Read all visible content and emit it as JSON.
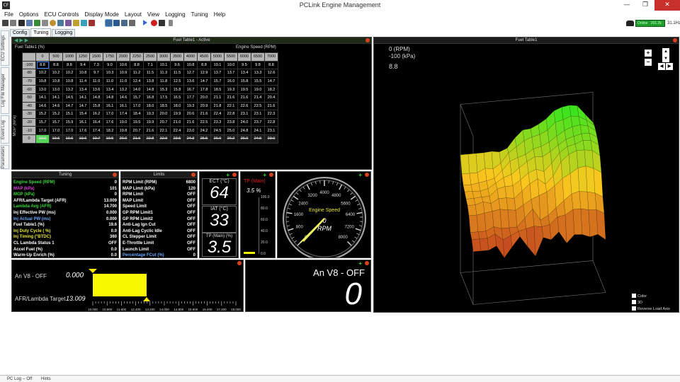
{
  "window": {
    "title": "PCLink Engine Management",
    "minimize": "—",
    "restore": "❐",
    "close": "✕",
    "app_icon": "CF"
  },
  "menu": [
    "File",
    "Options",
    "ECU Controls",
    "Display Mode",
    "Layout",
    "View",
    "Logging",
    "Tuning",
    "Help"
  ],
  "status_online": "Online",
  "status_online_value": "201.2k",
  "status_fps": "31.1Hz",
  "side_tabs": [
    "ECU Settings",
    "Log File Manager",
    "Event Log",
    "Parameters"
  ],
  "page_tabs": [
    "Config",
    "Tuning",
    "Logging"
  ],
  "fuel_table": {
    "title": "Fuel Table1 - Active",
    "table_label": "Fuel Table1 (%)",
    "rpm_label": "Engine Speed (RPM)",
    "map_label": "MGP (kPa)",
    "rpm": [
      "0",
      "500",
      "1000",
      "1250",
      "1500",
      "1750",
      "2000",
      "2250",
      "2500",
      "3000",
      "3500",
      "4000",
      "4500",
      "5000",
      "5500",
      "6000",
      "6500",
      "7000"
    ],
    "rows": [
      {
        "map": "-100",
        "cells": [
          "8.8",
          "8.8",
          "8.8",
          "9.4",
          "7.3",
          "9.0",
          "10.6",
          "8.8",
          "7.1",
          "10.1",
          "9.6",
          "10.8",
          "8.8",
          "10.1",
          "10.0",
          "9.5",
          "9.8",
          "8.8"
        ]
      },
      {
        "map": "-80",
        "cells": [
          "10.2",
          "10.2",
          "10.2",
          "10.8",
          "9.7",
          "10.3",
          "10.9",
          "11.2",
          "11.5",
          "11.3",
          "11.5",
          "12.7",
          "12.9",
          "13.7",
          "13.7",
          "13.4",
          "13.3",
          "12.6"
        ]
      },
      {
        "map": "-70",
        "cells": [
          "10.8",
          "10.8",
          "10.8",
          "11.4",
          "11.0",
          "11.0",
          "11.0",
          "12.4",
          "13.8",
          "11.8",
          "12.5",
          "13.6",
          "14.7",
          "15.7",
          "16.0",
          "15.8",
          "15.5",
          "14.7"
        ]
      },
      {
        "map": "-60",
        "cells": [
          "13.0",
          "13.0",
          "13.2",
          "13.4",
          "13.6",
          "13.4",
          "13.2",
          "14.0",
          "14.8",
          "15.3",
          "15.8",
          "16.7",
          "17.8",
          "18.5",
          "19.3",
          "19.5",
          "19.0",
          "18.2"
        ]
      },
      {
        "map": "-50",
        "cells": [
          "14.1",
          "14.1",
          "14.5",
          "14.1",
          "14.8",
          "14.8",
          "14.6",
          "15.7",
          "16.8",
          "17.5",
          "16.5",
          "17.7",
          "20.0",
          "21.1",
          "21.6",
          "21.6",
          "21.4",
          "20.4"
        ]
      },
      {
        "map": "-40",
        "cells": [
          "14.6",
          "14.6",
          "14.7",
          "14.7",
          "15.8",
          "16.1",
          "16.1",
          "17.0",
          "18.0",
          "18.5",
          "18.0",
          "19.3",
          "20.9",
          "21.8",
          "22.1",
          "22.6",
          "22.5",
          "21.6"
        ]
      },
      {
        "map": "-30",
        "cells": [
          "15.2",
          "15.2",
          "15.1",
          "15.4",
          "16.2",
          "17.0",
          "17.4",
          "18.4",
          "19.3",
          "20.0",
          "19.9",
          "20.6",
          "21.6",
          "22.4",
          "22.8",
          "23.1",
          "23.1",
          "22.3"
        ]
      },
      {
        "map": "-20",
        "cells": [
          "15.7",
          "15.7",
          "15.9",
          "16.1",
          "16.4",
          "17.6",
          "19.0",
          "19.5",
          "19.9",
          "20.7",
          "21.0",
          "21.6",
          "22.5",
          "23.3",
          "23.8",
          "24.0",
          "23.7",
          "22.8"
        ]
      },
      {
        "map": "-10",
        "cells": [
          "17.0",
          "17.0",
          "17.0",
          "17.6",
          "17.4",
          "18.2",
          "19.8",
          "20.7",
          "21.6",
          "22.1",
          "22.4",
          "23.0",
          "24.2",
          "24.5",
          "25.0",
          "24.8",
          "24.1",
          "23.1"
        ]
      },
      {
        "map": "0",
        "cells": [
          "19.6",
          "19.6",
          "19.6",
          "19.6",
          "19.7",
          "19.5",
          "20.0",
          "21.6",
          "22.8",
          "22.9",
          "23.5",
          "24.3",
          "25.5",
          "26.0",
          "26.2",
          "26.0",
          "24.5",
          "23.0"
        ]
      }
    ]
  },
  "graph3d": {
    "title": "Fuel Table1",
    "line1": "0 (RPM)",
    "line2": "-100 (kPa)",
    "value": "8.8",
    "checks": [
      "Color",
      "3D",
      "Reverse Load Axis"
    ]
  },
  "tuning": {
    "title": "Tuning",
    "items": [
      {
        "label": "Engine Speed (RPM)",
        "value": "0",
        "color": "#38d838"
      },
      {
        "label": "MAP (kPa)",
        "value": "101",
        "color": "#e040e0"
      },
      {
        "label": "MGP (kPa)",
        "value": "0",
        "color": "#38d838"
      },
      {
        "label": "AFR/Lambda Target (AFR)",
        "value": "13.009",
        "color": "#ffffff"
      },
      {
        "label": "Lambda Avg (AFR)",
        "value": "14.700",
        "color": "#38d838"
      },
      {
        "label": "Inj Effective PW (ms)",
        "value": "0.000",
        "color": "#ffffff"
      },
      {
        "label": "Inj Actual PW (ms)",
        "value": "0.000",
        "color": "#6aa8ff"
      },
      {
        "label": "Fuel Table1 (%)",
        "value": "19.6",
        "color": "#ffffff"
      },
      {
        "label": "Inj Duty Cycle ( %)",
        "value": "0.0",
        "color": "#e8e830"
      },
      {
        "label": "Inj Timing (°BTDC)",
        "value": "360",
        "color": "#e8e830"
      },
      {
        "label": "CL Lambda Status 1",
        "value": "OFF",
        "color": "#ffffff"
      },
      {
        "label": "Accel Fuel (%)",
        "value": "0.0",
        "color": "#ffffff"
      },
      {
        "label": "Warm-Up Enrich (%)",
        "value": "0.0",
        "color": "#ffffff"
      }
    ]
  },
  "limits": {
    "title": "Limits",
    "items": [
      {
        "label": "RPM Limit (RPM)",
        "value": "6800",
        "color": "#ffffff"
      },
      {
        "label": "MAP Limit (kPa)",
        "value": "120",
        "color": "#ffffff"
      },
      {
        "label": "RPM Limit",
        "value": "OFF",
        "color": "#ffffff"
      },
      {
        "label": "MAP Limit",
        "value": "OFF",
        "color": "#ffffff"
      },
      {
        "label": "Speed Limit",
        "value": "OFF",
        "color": "#ffffff"
      },
      {
        "label": "GP RPM Limit1",
        "value": "OFF",
        "color": "#ffffff"
      },
      {
        "label": "GP RPM Limit2",
        "value": "OFF",
        "color": "#ffffff"
      },
      {
        "label": "Anti-Lag Ign Cut",
        "value": "OFF",
        "color": "#ffffff"
      },
      {
        "label": "Anti-Lag Cyclic Idle",
        "value": "OFF",
        "color": "#ffffff"
      },
      {
        "label": "CL Stepper Limit",
        "value": "OFF",
        "color": "#ffffff"
      },
      {
        "label": "E-Throttle Limit",
        "value": "OFF",
        "color": "#ffffff"
      },
      {
        "label": "Launch Limit",
        "value": "OFF",
        "color": "#ffffff"
      },
      {
        "label": "Percentage FCut (%)",
        "value": "0",
        "color": "#6aa8ff"
      }
    ]
  },
  "gauges": {
    "ect_label": "ECT (°C)",
    "ect": "64",
    "iat_label": "IAT (°C)",
    "iat": "33",
    "tp_label": "TP (Main) (%)",
    "tp": "3.5",
    "tp_bar_label": "TP (Main)",
    "tp_bar_value": "3.5 %",
    "tp_bar_fraction": 0.035,
    "tp_scale": [
      "100.0",
      "80.0",
      "60.0",
      "40.0",
      "20.0",
      "0.0"
    ],
    "rpm_title": "Engine Speed",
    "rpm_value": "0",
    "rpm_unit": "RPM",
    "rpm_ticks": [
      "0",
      "800",
      "1600",
      "2400",
      "3200",
      "4000",
      "4800",
      "5600",
      "6400",
      "7200",
      "8000"
    ]
  },
  "afr": {
    "label1": "An V8 - OFF",
    "value1": "0.000",
    "label2": "AFR/Lambda Target",
    "value2": "13.009",
    "scale": [
      "10.000",
      "10.800",
      "11.600",
      "12.400",
      "13.200",
      "14.000",
      "14.800",
      "15.600",
      "16.400",
      "17.200",
      "18.000"
    ]
  },
  "v8": {
    "label": "An V8 - OFF",
    "value": "0"
  },
  "statusbar": {
    "log": "PC Log -- Off",
    "hints": "Hints"
  }
}
